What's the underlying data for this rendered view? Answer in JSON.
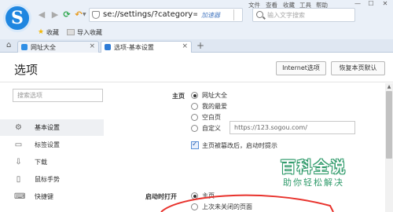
{
  "browser": {
    "logo_letter": "S",
    "menu": {
      "file": "文件",
      "view": "查看",
      "favorites": "收藏",
      "tools": "工具",
      "help": "帮助"
    },
    "window": {
      "minimize": "—",
      "maximize": "☐",
      "close": "✕"
    },
    "address": {
      "url": "se://settings/?category=gene",
      "accel_label": "加速器"
    },
    "search": {
      "placeholder": "输入文字搜索"
    },
    "favbar": {
      "favorites_label": "收藏",
      "import_label": "导入收藏"
    },
    "tabs": [
      {
        "label": "网址大全",
        "close": "×"
      },
      {
        "label": "选项-基本设置",
        "close": "×"
      }
    ],
    "new_tab": "+"
  },
  "page": {
    "title": "选项",
    "buttons": {
      "ie_options": "Internet选项",
      "restore": "恢复本页默认"
    },
    "settings_search": {
      "placeholder": "搜索选项"
    },
    "nav": [
      {
        "icon": "gear-icon",
        "label": "基本设置",
        "active": true
      },
      {
        "icon": "tabs-icon",
        "label": "标签设置"
      },
      {
        "icon": "download-icon",
        "label": "下载"
      },
      {
        "icon": "mouse-icon",
        "label": "鼠标手势"
      },
      {
        "icon": "keyboard-icon",
        "label": "快捷键"
      }
    ],
    "homepage": {
      "label": "主页",
      "options": [
        {
          "label": "网址大全",
          "checked": true
        },
        {
          "label": "我的最爱",
          "checked": false
        },
        {
          "label": "空白页",
          "checked": false
        },
        {
          "label": "自定义",
          "checked": false
        }
      ],
      "custom_url": "https://123.sogou.com/",
      "checkbox_label": "主页被篡改后，启动时提示"
    },
    "startup": {
      "label": "启动时打开",
      "options": [
        {
          "label": "主页",
          "checked": true
        },
        {
          "label": "上次未关闭的页面",
          "checked": false
        }
      ]
    }
  },
  "watermark": {
    "logo": "百科全说",
    "sub": "助你轻松解决"
  },
  "colors": {
    "accent": "#1f86e0",
    "annotation": "#e8322c",
    "watermark": "#2f9a6a"
  }
}
